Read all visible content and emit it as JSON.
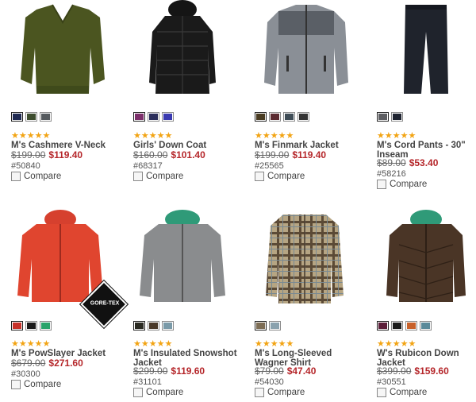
{
  "products": [
    {
      "name": "M's Cashmere V-Neck",
      "rating": "★★★★★",
      "was": "$199.00",
      "now": "$119.40",
      "item": "#50840",
      "compare": "Compare",
      "swatches": [
        "#1f2a52",
        "#3d4d2e",
        "#555a5e"
      ],
      "image": "sweater-image"
    },
    {
      "name": "Girls' Down Coat",
      "rating": "★★★★★",
      "was": "$160.00",
      "now": "$101.40",
      "item": "#68317",
      "compare": "Compare",
      "swatches": [
        "#7c2f6b",
        "#2c2f5c",
        "#3a3ab0"
      ],
      "image": "coat-image"
    },
    {
      "name": "M's Finmark Jacket",
      "rating": "★★★★★",
      "was": "$199.00",
      "now": "$119.40",
      "item": "#25565",
      "compare": "Compare",
      "swatches": [
        "#4a3c22",
        "#5b2a30",
        "#3e4c56",
        "#333333"
      ],
      "image": "fleece-jacket-image"
    },
    {
      "name": "M's Cord Pants - 30\" Inseam",
      "rating": "★★★★★",
      "was": "$89.00",
      "now": "$53.40",
      "item": "#58216",
      "compare": "Compare",
      "swatches": [
        "#5d5e62",
        "#1e2330"
      ],
      "image": "pants-image"
    },
    {
      "name": "M's PowSlayer Jacket",
      "rating": "★★★★★",
      "was": "$679.00",
      "now": "$271.60",
      "item": "#30300",
      "compare": "Compare",
      "swatches": [
        "#c8322a",
        "#1a1a1a",
        "#2aa36a"
      ],
      "image": "red-shell-jacket-image"
    },
    {
      "name": "M's Insulated Snowshot Jacket",
      "rating": "★★★★★",
      "was": "$299.00",
      "now": "$119.60",
      "item": "#31101",
      "compare": "Compare",
      "swatches": [
        "#2a2a22",
        "#4a3a2a",
        "#7a9aa8"
      ],
      "image": "gray-jacket-image"
    },
    {
      "name": "M's Long-Sleeved Wagner Shirt",
      "rating": "★★★★★",
      "was": "$79.00",
      "now": "$47.40",
      "item": "#54030",
      "compare": "Compare",
      "swatches": [
        "#7d6d55",
        "#8aa2ae"
      ],
      "image": "plaid-shirt-image"
    },
    {
      "name": "W's Rubicon Down Jacket",
      "rating": "★★★★★",
      "was": "$399.00",
      "now": "$159.60",
      "item": "#30551",
      "compare": "Compare",
      "swatches": [
        "#5c1f3a",
        "#1a1a1a",
        "#c8612a",
        "#5a8a9a"
      ],
      "image": "down-jacket-image"
    }
  ],
  "badge": {
    "text": "GORE-TEX"
  }
}
